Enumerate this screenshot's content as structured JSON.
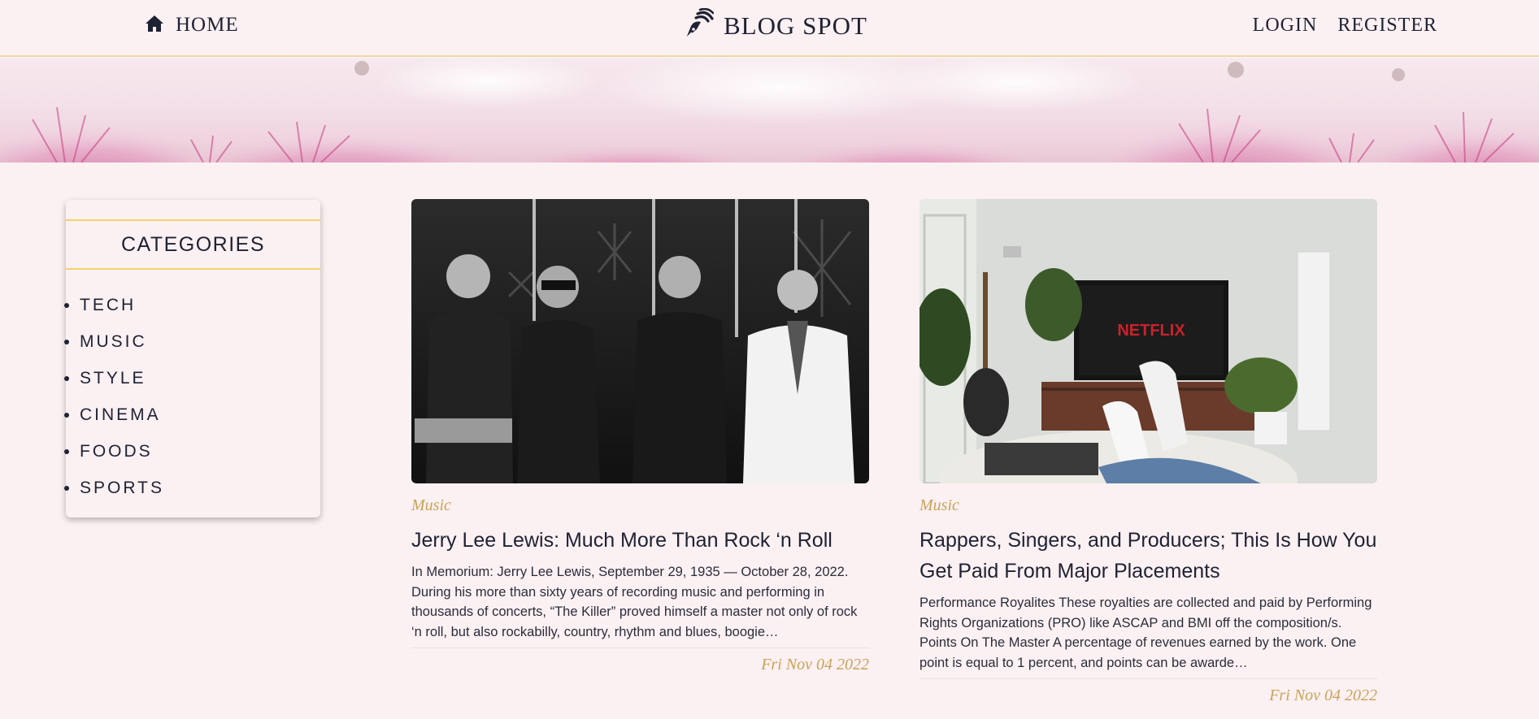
{
  "nav": {
    "home_label": "HOME",
    "brand_name": "BLOG SPOT",
    "login_label": "LOGIN",
    "register_label": "REGISTER"
  },
  "sidebar": {
    "heading": "CATEGORIES",
    "items": [
      {
        "label": "TECH"
      },
      {
        "label": "MUSIC"
      },
      {
        "label": "STYLE"
      },
      {
        "label": "CINEMA"
      },
      {
        "label": "FOODS"
      },
      {
        "label": "SPORTS"
      }
    ]
  },
  "posts": [
    {
      "category": "Music",
      "title": "Jerry Lee Lewis: Much More Than Rock ‘n Roll",
      "excerpt": "In Memorium: Jerry Lee Lewis, September 29, 1935 — October 28, 2022. During his more than sixty years of recording music and performing in thousands of concerts, “The Killer” proved himself a master not only of rock ‘n roll, but also rockabilly, country, rhythm and blues, boogie…",
      "date": "Fri Nov 04 2022"
    },
    {
      "category": "Music",
      "title": "Rappers, Singers, and Producers; This Is How You Get Paid From Major Placements",
      "excerpt": "Performance Royalites These royalties are collected and paid by Performing Rights Organizations (PRO) like ASCAP and BMI off the composition/s. Points On The Master A percentage of revenues earned by the work. One point is equal to 1 percent, and points can be awarde…",
      "date": "Fri Nov 04 2022",
      "image_text": "NETFLIX"
    }
  ],
  "colors": {
    "background": "#fbf0f2",
    "accent_gold": "#c9a455",
    "divider_yellow": "#f2d36b",
    "text_dark": "#1f2233"
  },
  "icons": {
    "home": "home-icon",
    "brand": "fountain-pen-nib-icon"
  }
}
